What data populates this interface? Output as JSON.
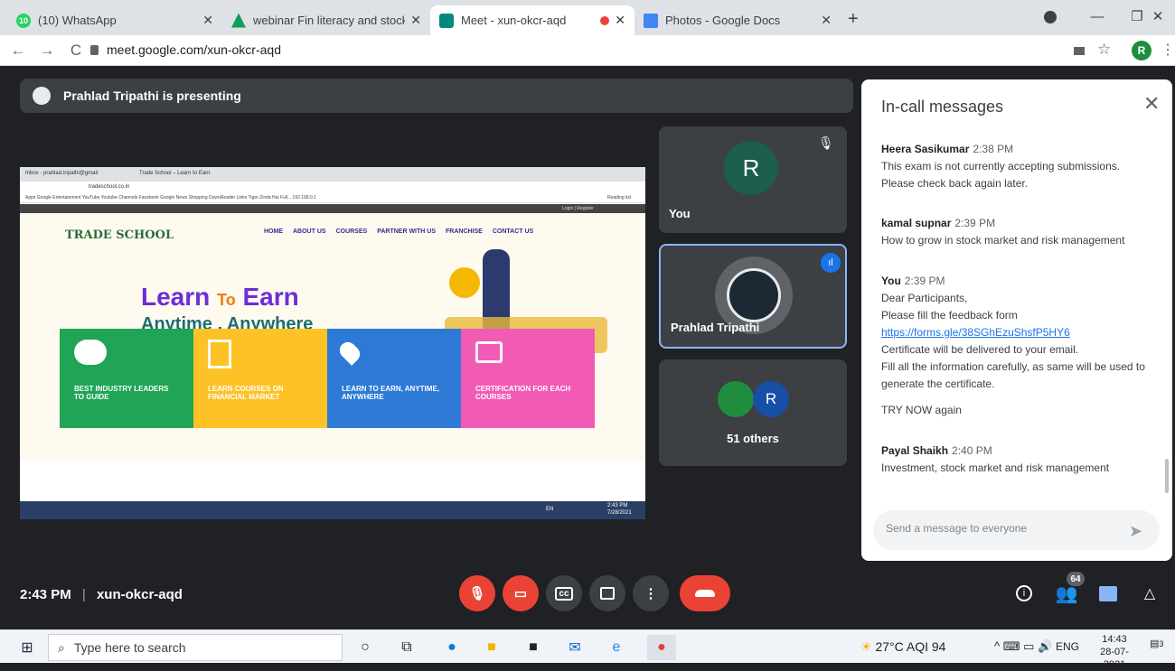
{
  "tabs": [
    {
      "title": "(10) WhatsApp",
      "badge": "10"
    },
    {
      "title": "webinar Fin literacy and stock M"
    },
    {
      "title": "Meet - xun-okcr-aqd"
    },
    {
      "title": "Photos - Google Docs"
    }
  ],
  "address": {
    "url": "meet.google.com/xun-okcr-aqd",
    "profile": "R"
  },
  "meet": {
    "presenting": "Prahlad Tripathi is presenting",
    "tiles": [
      {
        "name": "You",
        "avatar": "R"
      },
      {
        "name": "Prahlad Tripathi"
      },
      {
        "name": "51 others",
        "avatar": "R"
      }
    ],
    "time": "2:43 PM",
    "separator": "|",
    "code": "xun-okcr-aqd",
    "people_count": "64"
  },
  "shared_screen": {
    "tab1": "Inbox - prahlad.tripathi@gmail",
    "tab2": "Trade School – Learn to Earn",
    "url": "tradeschool.co.in",
    "bookmarks": "Apps  Google  Entertainment  YouTube  Youtube Channels  Facebook  Google News  Shopping  DownReader Links  Tiger Zinda Hai Full...  192.168.0.1",
    "reading_list": "Reading list",
    "login": "Login | Register",
    "logo": "TRADE SCHOOL",
    "nav": [
      "HOME",
      "ABOUT US",
      "COURSES",
      "PARTNER WITH US",
      "FRANCHISE",
      "CONTACT US"
    ],
    "hero1": "Learn",
    "hero2": "To",
    "hero3": "Earn",
    "hero4": "Anytime , Anywhere",
    "cards": [
      {
        "text": "BEST INDUSTRY LEADERS TO GUIDE",
        "color": "#1fa555"
      },
      {
        "text": "LEARN COURSES ON FINANCIAL MARKET",
        "color": "#fdc226"
      },
      {
        "text": "LEARN TO EARN, ANYTIME, ANYWHERE",
        "color": "#2d7ad6"
      },
      {
        "text": "CERTIFICATION FOR EACH COURSES",
        "color": "#f15bb5"
      }
    ],
    "tray_lang": "EN",
    "tray_time": "2:43 PM",
    "tray_date": "7/28/2021"
  },
  "chat": {
    "title": "In-call messages",
    "messages": [
      {
        "sender": "Heera Sasikumar",
        "time": "2:38 PM",
        "lines": [
          "This exam is not currently accepting submissions.",
          "Please check back again later."
        ]
      },
      {
        "sender": "kamal supnar",
        "time": "2:39 PM",
        "lines": [
          "How to grow in stock market and risk management"
        ]
      },
      {
        "sender": "You",
        "time": "2:39 PM",
        "lines": [
          "Dear Participants,",
          "Please fill the feedback form"
        ],
        "link": "https://forms.gle/38SGhEzuShsfP5HY6",
        "after": [
          "Certificate will be delivered to your email.",
          "Fill all the information carefully, as same will be used to generate the certificate.",
          "",
          "TRY NOW again"
        ]
      },
      {
        "sender": "Payal Shaikh",
        "time": "2:40 PM",
        "lines": [
          "Investment, stock market and risk management"
        ]
      }
    ],
    "input_placeholder": "Send a message to everyone"
  },
  "taskbar": {
    "search": "Type here to search",
    "weather": "27°C  AQI 94",
    "lang": "ENG",
    "time": "14:43",
    "date": "28-07-2021",
    "notif": "3"
  },
  "colors": {
    "meet_bg": "#202124",
    "tile_bg": "#3c4043",
    "accent": "#8ab4f8",
    "danger": "#ea4335"
  }
}
